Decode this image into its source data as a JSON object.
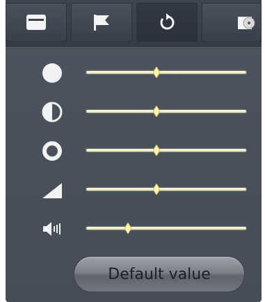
{
  "toolbar": {
    "buttons": [
      {
        "icon": "card-icon"
      },
      {
        "icon": "flag-icon"
      },
      {
        "icon": "refresh-icon"
      },
      {
        "icon": "disc-icon"
      }
    ]
  },
  "sliders": [
    {
      "name": "brightness",
      "icon": "brightness-icon",
      "value": 0.44
    },
    {
      "name": "contrast",
      "icon": "contrast-icon",
      "value": 0.44
    },
    {
      "name": "saturation",
      "icon": "saturation-icon",
      "value": 0.44
    },
    {
      "name": "gain",
      "icon": "ramp-icon",
      "value": 0.44
    },
    {
      "name": "volume",
      "icon": "volume-icon",
      "value": 0.26
    }
  ],
  "default_button": {
    "label": "Default value"
  },
  "colors": {
    "panel": "#4b515b",
    "toolbar": "#3a404a",
    "track": "#f7f2cf",
    "icon": "#f2f2f2"
  }
}
